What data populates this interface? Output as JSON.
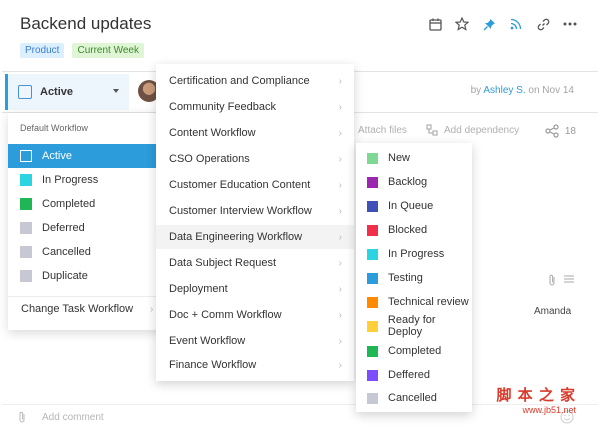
{
  "header": {
    "title": "Backend updates",
    "tags": [
      "Product",
      "Current Week"
    ]
  },
  "toolbar_icons": [
    "calendar-icon",
    "star-icon",
    "pin-icon",
    "rss-icon",
    "link-icon",
    "more-icon"
  ],
  "status": {
    "current": "Active",
    "byline_prefix": "by",
    "author": "Ashley S.",
    "date_text": "on Nov 14"
  },
  "actions": {
    "attach": "Attach files",
    "dependency": "Add dependency",
    "share_count": "18"
  },
  "assignee": "Amanda",
  "comment_placeholder": "Add comment",
  "workflow_panel": {
    "header": "Default Workflow",
    "statuses": [
      {
        "label": "Active",
        "color": "#2d9cdb",
        "active": true
      },
      {
        "label": "In Progress",
        "color": "#2bd4e0"
      },
      {
        "label": "Completed",
        "color": "#1fb656"
      },
      {
        "label": "Deferred",
        "color": "#c6c9d4"
      },
      {
        "label": "Cancelled",
        "color": "#c6c9d4"
      },
      {
        "label": "Duplicate",
        "color": "#c6c9d4"
      }
    ],
    "change_label": "Change Task Workflow"
  },
  "workflows": [
    "Certification and Compliance",
    "Community Feedback",
    "Content Workflow",
    "CSO Operations",
    "Customer Education Content",
    "Customer Interview Workflow",
    "Data Engineering Workflow",
    "Data Subject Request",
    "Deployment",
    "Doc + Comm Workflow",
    "Event Workflow",
    "Finance Workflow"
  ],
  "highlighted_workflow": "Data Engineering Workflow",
  "sub_statuses": [
    {
      "label": "New",
      "color": "#7ed894"
    },
    {
      "label": "Backlog",
      "color": "#9b27af"
    },
    {
      "label": "In Queue",
      "color": "#3f51b5"
    },
    {
      "label": "Blocked",
      "color": "#f0304a"
    },
    {
      "label": "In Progress",
      "color": "#2bd4e0"
    },
    {
      "label": "Testing",
      "color": "#2d9cdb"
    },
    {
      "label": "Technical review",
      "color": "#ff8a00"
    },
    {
      "label": "Ready for Deploy",
      "color": "#ffcf3a"
    },
    {
      "label": "Completed",
      "color": "#1fb656"
    },
    {
      "label": "Deffered",
      "color": "#7c4dff"
    },
    {
      "label": "Cancelled",
      "color": "#c6c9d4"
    }
  ],
  "watermark": {
    "text": "脚 本 之 家",
    "url": "www.jb51.net"
  }
}
